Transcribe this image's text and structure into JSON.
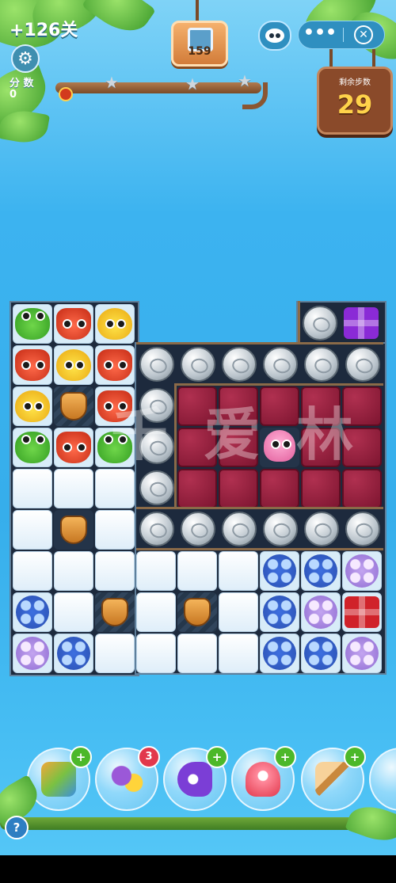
{
  "hud": {
    "level_bonus": "+126关",
    "score_label": "分 数",
    "score_value": "0",
    "goal_count": "159",
    "moves_label": "剩余步数",
    "moves_value": "29",
    "stars": 3,
    "more_label": "•••",
    "close_label": "✕",
    "help_label": "?"
  },
  "watermark": "千 爱 林",
  "boosters": [
    {
      "icon": "board-shuffle-icon",
      "badge": "+",
      "badge_type": "plus"
    },
    {
      "icon": "swap-icon",
      "badge": "3",
      "badge_type": "count"
    },
    {
      "icon": "rocket-horizontal-icon",
      "badge": "+",
      "badge_type": "plus"
    },
    {
      "icon": "rocket-vertical-icon",
      "badge": "+",
      "badge_type": "plus"
    },
    {
      "icon": "hammer-icon",
      "badge": "+",
      "badge_type": "plus"
    }
  ],
  "colors": {
    "jam": "#8a1a36",
    "coin": "#c7d0d7",
    "board": "#1d2a3d",
    "moves_panel": "#8a4a2a",
    "moves_number": "#ffd34a"
  }
}
